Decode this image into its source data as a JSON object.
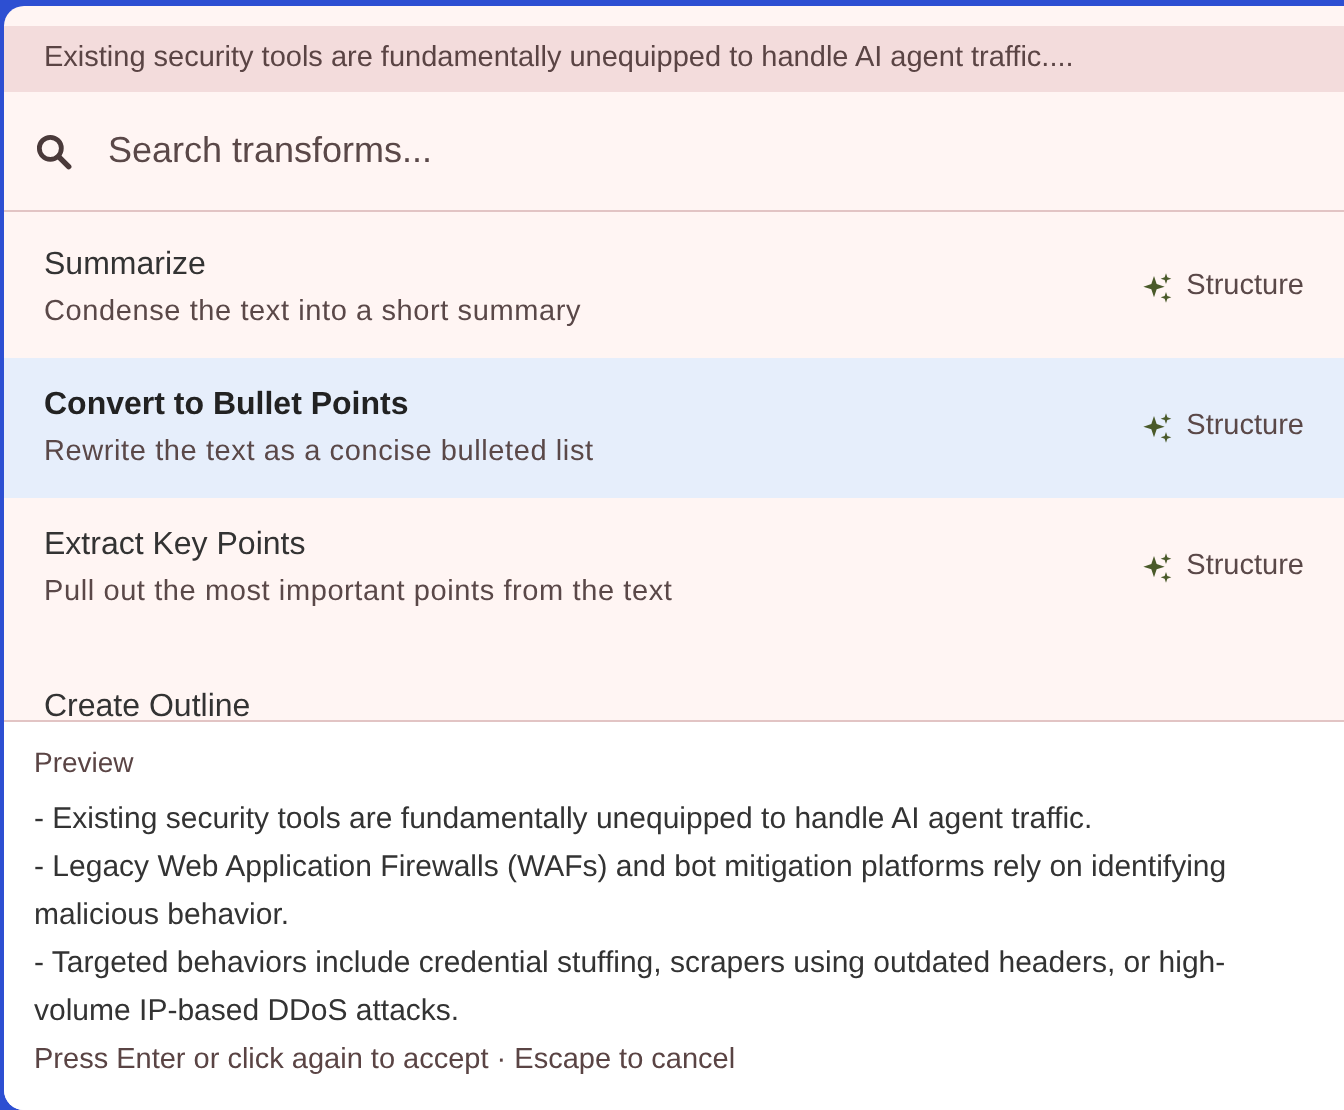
{
  "source_excerpt": "Existing security tools are fundamentally unequipped to handle AI agent traffic....",
  "search": {
    "placeholder": "Search transforms..."
  },
  "transforms": [
    {
      "title": "Summarize",
      "description": "Condense the text into a short summary",
      "tag": "Structure",
      "selected": false
    },
    {
      "title": "Convert to Bullet Points",
      "description": "Rewrite the text as a concise bulleted list",
      "tag": "Structure",
      "selected": true
    },
    {
      "title": "Extract Key Points",
      "description": "Pull out the most important points from the text",
      "tag": "Structure",
      "selected": false
    },
    {
      "title": "Create Outline",
      "selected": false
    }
  ],
  "preview": {
    "label": "Preview",
    "lines": [
      "- Existing security tools are fundamentally unequipped to handle AI agent traffic.",
      "- Legacy Web Application Firewalls (WAFs) and bot mitigation platforms rely on identifying malicious behavior.",
      "- Targeted behaviors include credential stuffing, scrapers using outdated headers, or high-volume IP-based DDoS attacks."
    ],
    "hint": "Press Enter or click again to accept · Escape to cancel"
  }
}
